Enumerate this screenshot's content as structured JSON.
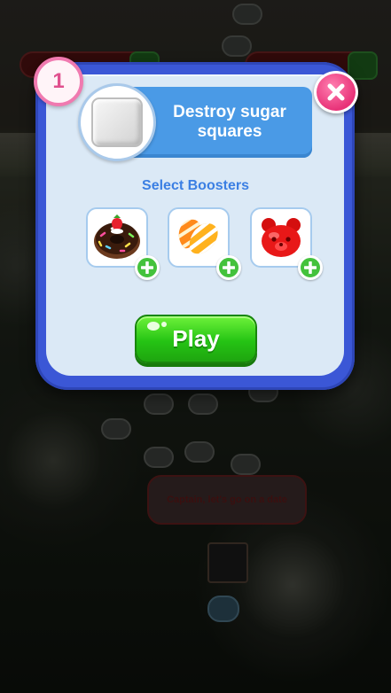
{
  "level": {
    "number": "1"
  },
  "goal": {
    "text": "Destroy sugar squares",
    "icon": "sugar-square-icon"
  },
  "boosters": {
    "title": "Select Boosters",
    "items": [
      {
        "name": "donut-booster-icon"
      },
      {
        "name": "striped-candy-booster-icon"
      },
      {
        "name": "jelly-bear-booster-icon"
      }
    ]
  },
  "play": {
    "label": "Play"
  },
  "background": {
    "speech_text": "Captain, let's go on a date"
  },
  "colors": {
    "dialog_frame": "#3b57d6",
    "dialog_body": "#dbe9f6",
    "goal_bar": "#4a9ae6",
    "play_green": "#25c414",
    "close_pink": "#e83278"
  }
}
